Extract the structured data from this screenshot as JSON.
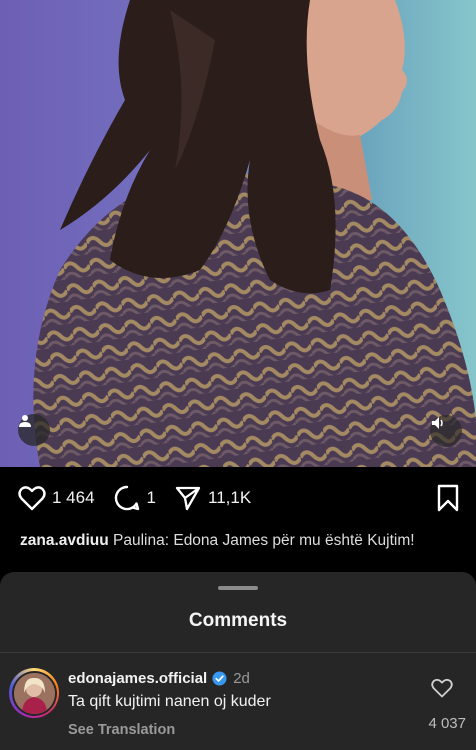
{
  "post": {
    "likes": "1 464",
    "comments": "1",
    "shares": "11,1K"
  },
  "caption": {
    "username": "zana.avdiuu",
    "text": "Paulina: Edona James për mu është Kujtim!"
  },
  "sheet": {
    "title": "Comments"
  },
  "comment": {
    "username": "edonajames.official",
    "time": "2d",
    "text": "Ta qift kujtimi nanen oj kuder",
    "translate": "See Translation",
    "likes": "4 037"
  },
  "icons": {
    "like": "heart-icon",
    "comment": "comment-bubble-icon",
    "share": "paper-plane-icon",
    "save": "bookmark-icon",
    "user_tag": "person-icon",
    "audio": "speaker-icon",
    "verified": "verified-badge-icon"
  },
  "colors": {
    "background": "#000000",
    "sheet": "#262626",
    "verified": "#3897f0",
    "muted_text": "#9a9a9a"
  }
}
